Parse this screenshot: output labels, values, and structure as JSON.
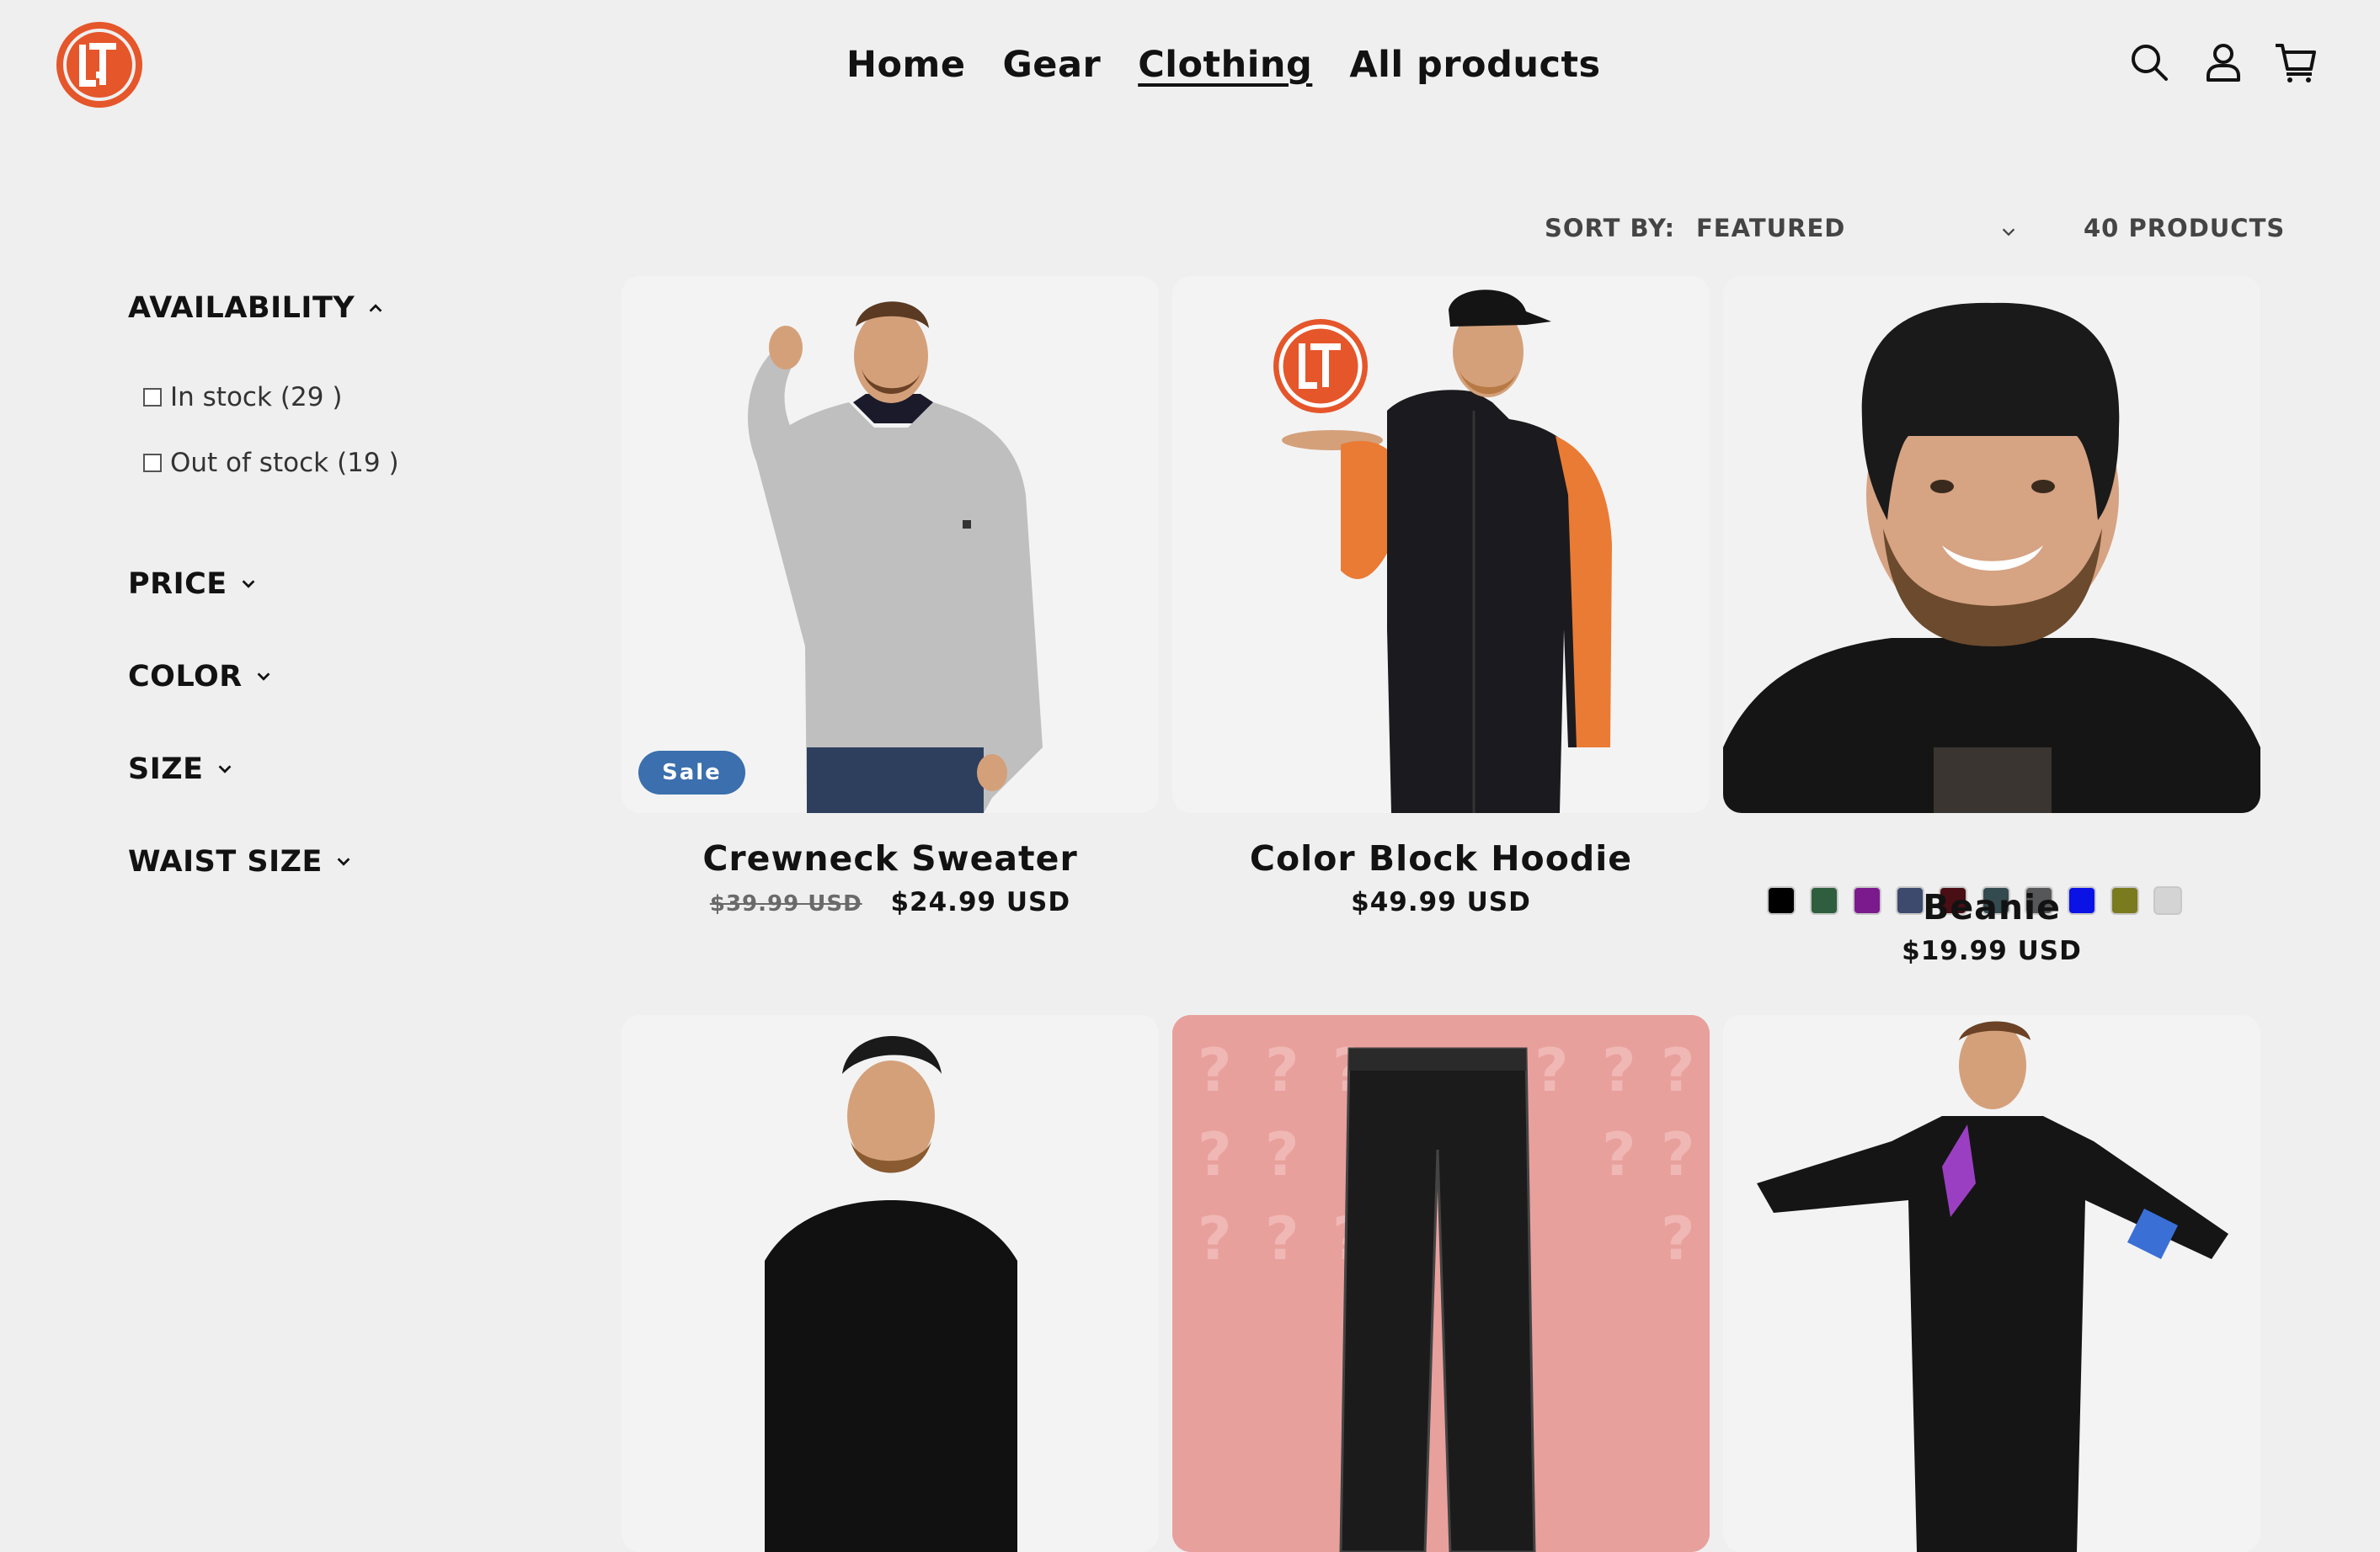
{
  "header": {
    "logo_label": "LTT",
    "nav": [
      "Home",
      "Gear",
      "Clothing",
      "All products"
    ],
    "active_nav": "Clothing",
    "icons": [
      "search-icon",
      "account-icon",
      "cart-icon"
    ]
  },
  "toolbar": {
    "sort_label": "SORT BY:",
    "sort_value": "FEATURED",
    "product_count": "40 PRODUCTS"
  },
  "filters": {
    "availability": {
      "title": "AVAILABILITY",
      "options": [
        {
          "label": "In stock",
          "count": "(29 )"
        },
        {
          "label": "Out of stock",
          "count": "(19 )"
        }
      ]
    },
    "price": "PRICE",
    "color": "COLOR",
    "size": "SIZE",
    "waist_size": "WAIST SIZE"
  },
  "products": [
    {
      "title": "Crewneck Sweater",
      "badge": "Sale",
      "compare_price": "$39.99 USD",
      "price": "$24.99 USD"
    },
    {
      "title": "Color Block Hoodie",
      "price": "$49.99 USD"
    },
    {
      "title": "Beanie",
      "price": "$19.99 USD",
      "swatch_colors": [
        "#000000",
        "#2e5e3e",
        "#7b1a8c",
        "#3d4a6e",
        "#4a0e15",
        "#334a4e",
        "#555759",
        "#0a12e6",
        "#7a7a1e",
        "#d4d4d4"
      ]
    }
  ],
  "colors": {
    "background": "#efefef",
    "accent_orange": "#e5562b",
    "sale_badge": "#3b6fad",
    "promo_pink": "#e8a09d"
  }
}
